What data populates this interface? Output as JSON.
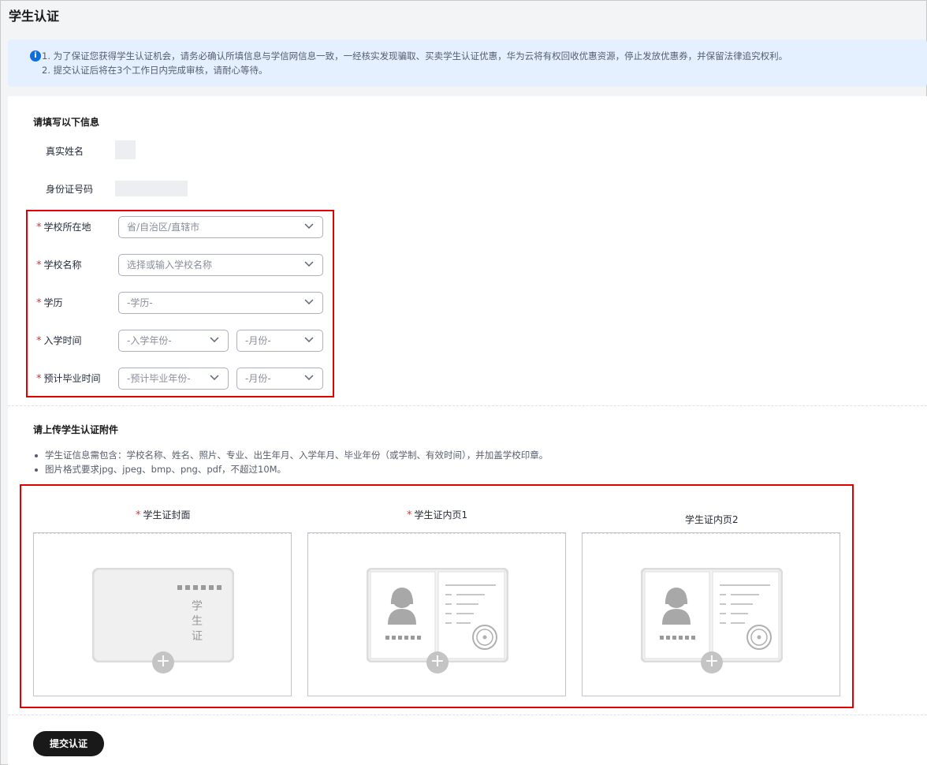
{
  "page": {
    "title": "学生认证"
  },
  "notice": {
    "line1": "1. 为了保证您获得学生认证机会，请务必确认所填信息与学信网信息一致，一经核实发现骗取、买卖学生认证优惠，华为云将有权回收优惠资源，停止发放优惠券，并保留法律追究权利。",
    "line2": "2. 提交认证后将在3个工作日内完成审核，请耐心等待。",
    "icon": "info-icon"
  },
  "info_section": {
    "title": "请填写以下信息",
    "real_name_label": "真实姓名",
    "id_number_label": "身份证号码"
  },
  "form": {
    "required_mark": "*",
    "school_location": {
      "label": "学校所在地",
      "placeholder": "省/自治区/直辖市"
    },
    "school_name": {
      "label": "学校名称",
      "placeholder": "选择或输入学校名称"
    },
    "education": {
      "label": "学历",
      "placeholder": "-学历-"
    },
    "enrollment": {
      "label": "入学时间",
      "year_placeholder": "-入学年份-",
      "month_placeholder": "-月份-"
    },
    "graduation": {
      "label": "预计毕业时间",
      "year_placeholder": "-预计毕业年份-",
      "month_placeholder": "-月份-"
    }
  },
  "upload_section": {
    "title": "请上传学生认证附件",
    "bullets": [
      "学生证信息需包含：学校名称、姓名、照片、专业、出生年月、入学年月、毕业年份（或学制、有效时间），并加盖学校印章。",
      "图片格式要求jpg、jpeg、bmp、png、pdf，不超过10M。"
    ],
    "slots": [
      {
        "label": "学生证封面",
        "required": true
      },
      {
        "label": "学生证内页1",
        "required": true
      },
      {
        "label": "学生证内页2",
        "required": false
      }
    ],
    "cover_text": [
      "学",
      "生",
      "证"
    ],
    "plus_symbol": "+"
  },
  "submit_label": "提交认证",
  "colors": {
    "accent_red": "#e10000",
    "info_blue": "#0f6fdc",
    "button_black": "#191919"
  }
}
